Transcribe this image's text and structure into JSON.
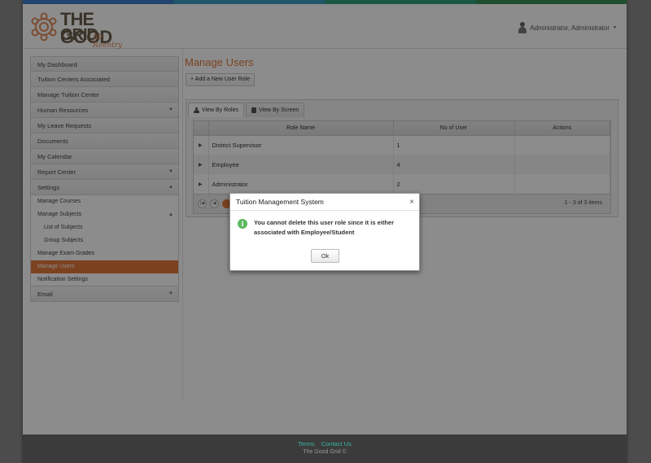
{
  "brand": {
    "line1": "THE GOOD",
    "line2": "GRID",
    "tagline": "for Reentry"
  },
  "topbar_colors": [
    "#3b7dc8",
    "#3aa0c4",
    "#2fa07f",
    "#3a8f52"
  ],
  "user_menu": {
    "label": "Administrator, Administrator",
    "icon": "user-icon"
  },
  "sidebar": {
    "items": [
      {
        "label": "My Dashboard"
      },
      {
        "label": "Tuition Centers Associated"
      },
      {
        "label": "Manage Tuition Center"
      },
      {
        "label": "Human Resources",
        "caret": "▼"
      },
      {
        "label": "My Leave Requests"
      },
      {
        "label": "Documents"
      },
      {
        "label": "My Calendar"
      },
      {
        "label": "Report Center",
        "caret": "▼"
      },
      {
        "label": "Settings",
        "caret": "▲"
      }
    ],
    "settings_children": [
      {
        "label": "Manage Courses"
      },
      {
        "label": "Manage Subjects",
        "caret": "▲"
      },
      {
        "label": "List of Subjects"
      },
      {
        "label": "Group Subjects"
      },
      {
        "label": "Manage Exam Grades"
      },
      {
        "label": "Manage Users"
      },
      {
        "label": "Notification Settings"
      }
    ],
    "email": {
      "label": "Email",
      "caret": "▼"
    }
  },
  "main": {
    "title": "Manage Users",
    "add_button": "Add a New User Role",
    "tabs": [
      {
        "label": "View By Roles",
        "icon": "user-icon"
      },
      {
        "label": "View By Screen",
        "icon": "book-icon"
      }
    ],
    "grid": {
      "columns": [
        "Role Name",
        "No of User",
        "Actions"
      ],
      "rows": [
        {
          "role": "District Supervisor",
          "count": "1"
        },
        {
          "role": "Employee",
          "count": "4"
        },
        {
          "role": "Administrator",
          "count": "2"
        }
      ],
      "pager_info": "1 - 3 of 3 items"
    }
  },
  "modal": {
    "title": "Tuition Management System",
    "close": "×",
    "message_line1": "You cannot delete this user role since it is either",
    "message_line2": "associated with Employee/Student",
    "ok": "Ok"
  },
  "footer": {
    "terms": "Terms",
    "contact": "Contact Us",
    "copy": "The Good Grid ©"
  }
}
